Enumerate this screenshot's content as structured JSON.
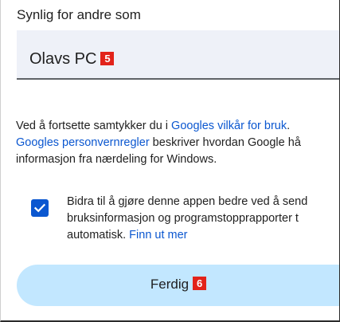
{
  "field": {
    "label": "Synlig for andre som",
    "value": "Olavs PC",
    "badge": "5"
  },
  "consent": {
    "line1_pre": "Ved å fortsette samtykker du i ",
    "line1_link": "Googles vilkår for bruk",
    "line1_post": ".",
    "line2_link": "Googles personvernregler",
    "line2_post": " beskriver hvordan Google hå",
    "line3": "informasjon fra nærdeling for Windows."
  },
  "checkbox": {
    "checked": true,
    "line1": "Bidra til å gjøre denne appen bedre ved å send",
    "line2": "bruksinformasjon og programstopprapporter t",
    "line3_pre": "automatisk. ",
    "line3_link": "Finn ut mer"
  },
  "done_button": {
    "label": "Ferdig",
    "badge": "6"
  },
  "colors": {
    "accent": "#0b57d0",
    "button_bg": "#c2e7ff",
    "badge": "#e2231a",
    "field_bg": "#eef1f8"
  }
}
